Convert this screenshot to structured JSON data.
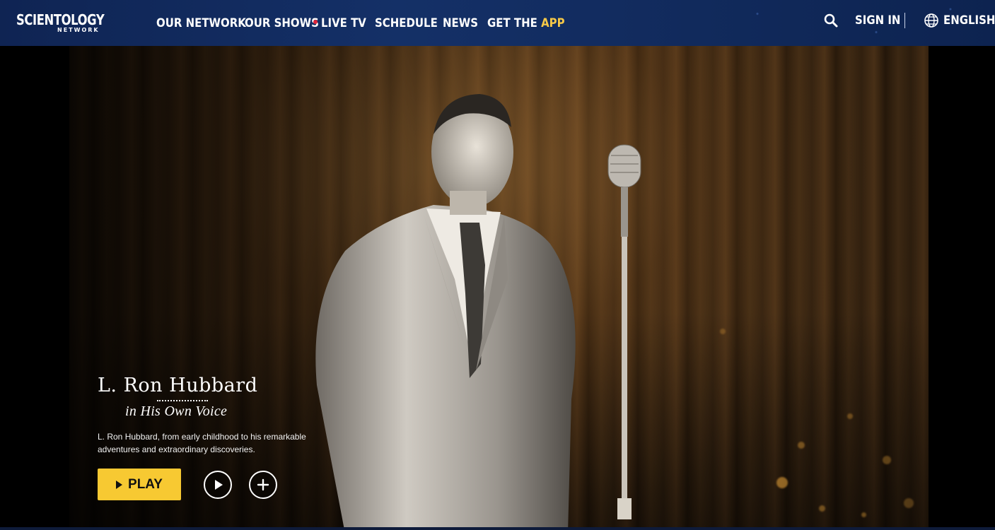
{
  "brand": {
    "name": "SCIENTOLOGY",
    "sub": "NETWORK"
  },
  "nav": {
    "items": [
      {
        "label": "OUR NETWORK"
      },
      {
        "label": "OUR SHOWS"
      },
      {
        "label": "LIVE TV"
      },
      {
        "label": "SCHEDULE"
      },
      {
        "label": "NEWS"
      }
    ],
    "get_the": "GET THE",
    "app": "APP"
  },
  "header_right": {
    "search_icon": "search-icon",
    "sign_in": "SIGN IN",
    "language_icon": "globe-icon",
    "language": "ENGLISH"
  },
  "hero": {
    "title": "L. Ron Hubbard",
    "subtitle": "in His Own Voice",
    "description": "L. Ron Hubbard, from early childhood to his remarkable adventures and extraordinary discoveries.",
    "play_label": "PLAY",
    "play_icon": "play-icon",
    "trailer_icon": "play-circle-icon",
    "add_icon": "plus-icon"
  },
  "colors": {
    "header_bg": "#143067",
    "accent_yellow": "#f7c932",
    "live_red": "#e0263a"
  }
}
